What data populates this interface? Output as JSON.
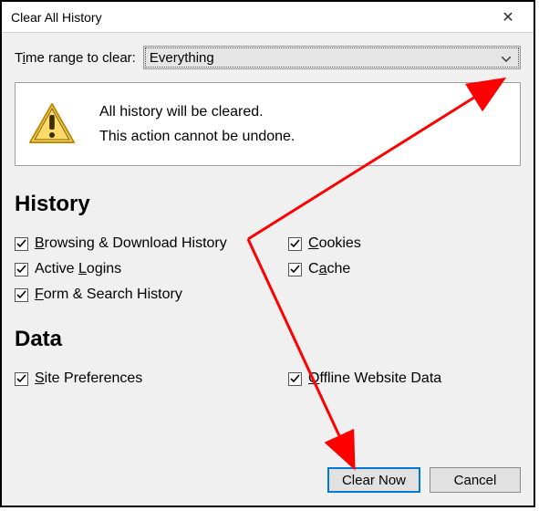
{
  "title": "Clear All History",
  "timerange": {
    "label_pre": "T",
    "label_underline": "i",
    "label_post": "me range to clear:",
    "selected": "Everything"
  },
  "warning": {
    "line1": "All history will be cleared.",
    "line2": "This action cannot be undone."
  },
  "sections": {
    "history": "History",
    "data": "Data"
  },
  "checks": {
    "browsing": {
      "ul": "B",
      "rest": "rowsing & Download History"
    },
    "cookies": {
      "ul": "C",
      "rest": "ookies"
    },
    "logins": {
      "pre": "Active ",
      "ul": "L",
      "rest": "ogins"
    },
    "cache": {
      "pre": "C",
      "ul": "a",
      "rest": "che"
    },
    "form": {
      "ul": "F",
      "rest": "orm & Search History"
    },
    "siteprefs": {
      "ul": "S",
      "rest": "ite Preferences"
    },
    "offline": {
      "ul": "O",
      "rest": "ffline Website Data"
    }
  },
  "buttons": {
    "clear": "Clear Now",
    "cancel": "Cancel"
  }
}
